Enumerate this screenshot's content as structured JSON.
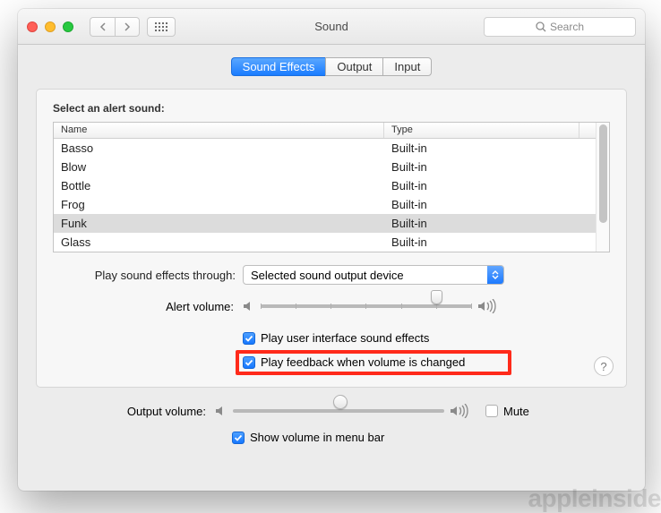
{
  "window": {
    "title": "Sound"
  },
  "search": {
    "placeholder": "Search"
  },
  "tabs": {
    "sound_effects": "Sound Effects",
    "output": "Output",
    "input": "Input"
  },
  "panel": {
    "title": "Select an alert sound:",
    "columns": {
      "name": "Name",
      "type": "Type"
    },
    "sounds": [
      {
        "name": "Basso",
        "type": "Built-in"
      },
      {
        "name": "Blow",
        "type": "Built-in"
      },
      {
        "name": "Bottle",
        "type": "Built-in"
      },
      {
        "name": "Frog",
        "type": "Built-in"
      },
      {
        "name": "Funk",
        "type": "Built-in"
      },
      {
        "name": "Glass",
        "type": "Built-in"
      }
    ],
    "selected_index": 4,
    "play_through_label": "Play sound effects through:",
    "play_through_value": "Selected sound output device",
    "alert_volume_label": "Alert volume:",
    "cb_ui_sounds": "Play user interface sound effects",
    "cb_feedback": "Play feedback when volume is changed"
  },
  "output": {
    "label": "Output volume:",
    "mute": "Mute",
    "show_in_menu": "Show volume in menu bar"
  },
  "watermark": "appleinside"
}
